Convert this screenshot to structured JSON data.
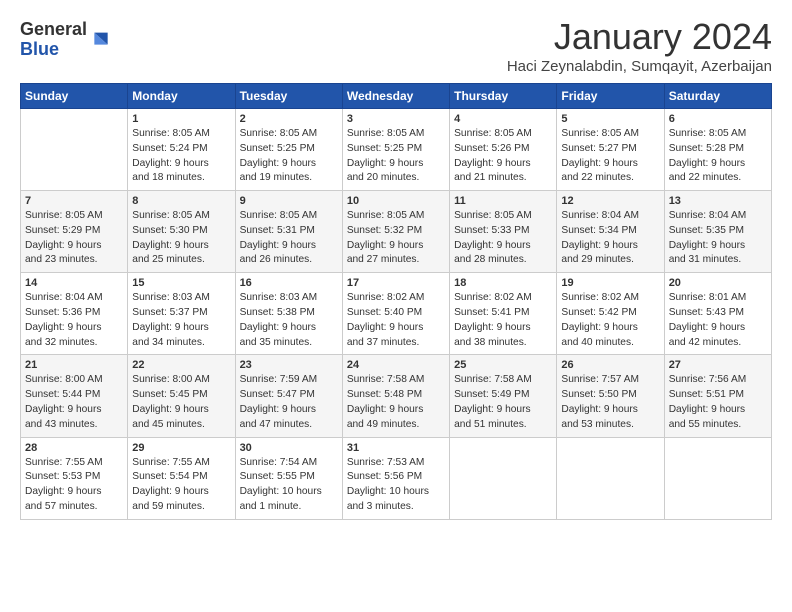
{
  "logo": {
    "general": "General",
    "blue": "Blue"
  },
  "header": {
    "month": "January 2024",
    "location": "Haci Zeynalabdin, Sumqayit, Azerbaijan"
  },
  "weekdays": [
    "Sunday",
    "Monday",
    "Tuesday",
    "Wednesday",
    "Thursday",
    "Friday",
    "Saturday"
  ],
  "weeks": [
    [
      {
        "day": "",
        "info": ""
      },
      {
        "day": "1",
        "info": "Sunrise: 8:05 AM\nSunset: 5:24 PM\nDaylight: 9 hours\nand 18 minutes."
      },
      {
        "day": "2",
        "info": "Sunrise: 8:05 AM\nSunset: 5:25 PM\nDaylight: 9 hours\nand 19 minutes."
      },
      {
        "day": "3",
        "info": "Sunrise: 8:05 AM\nSunset: 5:25 PM\nDaylight: 9 hours\nand 20 minutes."
      },
      {
        "day": "4",
        "info": "Sunrise: 8:05 AM\nSunset: 5:26 PM\nDaylight: 9 hours\nand 21 minutes."
      },
      {
        "day": "5",
        "info": "Sunrise: 8:05 AM\nSunset: 5:27 PM\nDaylight: 9 hours\nand 22 minutes."
      },
      {
        "day": "6",
        "info": "Sunrise: 8:05 AM\nSunset: 5:28 PM\nDaylight: 9 hours\nand 22 minutes."
      }
    ],
    [
      {
        "day": "7",
        "info": "Sunrise: 8:05 AM\nSunset: 5:29 PM\nDaylight: 9 hours\nand 23 minutes."
      },
      {
        "day": "8",
        "info": "Sunrise: 8:05 AM\nSunset: 5:30 PM\nDaylight: 9 hours\nand 25 minutes."
      },
      {
        "day": "9",
        "info": "Sunrise: 8:05 AM\nSunset: 5:31 PM\nDaylight: 9 hours\nand 26 minutes."
      },
      {
        "day": "10",
        "info": "Sunrise: 8:05 AM\nSunset: 5:32 PM\nDaylight: 9 hours\nand 27 minutes."
      },
      {
        "day": "11",
        "info": "Sunrise: 8:05 AM\nSunset: 5:33 PM\nDaylight: 9 hours\nand 28 minutes."
      },
      {
        "day": "12",
        "info": "Sunrise: 8:04 AM\nSunset: 5:34 PM\nDaylight: 9 hours\nand 29 minutes."
      },
      {
        "day": "13",
        "info": "Sunrise: 8:04 AM\nSunset: 5:35 PM\nDaylight: 9 hours\nand 31 minutes."
      }
    ],
    [
      {
        "day": "14",
        "info": "Sunrise: 8:04 AM\nSunset: 5:36 PM\nDaylight: 9 hours\nand 32 minutes."
      },
      {
        "day": "15",
        "info": "Sunrise: 8:03 AM\nSunset: 5:37 PM\nDaylight: 9 hours\nand 34 minutes."
      },
      {
        "day": "16",
        "info": "Sunrise: 8:03 AM\nSunset: 5:38 PM\nDaylight: 9 hours\nand 35 minutes."
      },
      {
        "day": "17",
        "info": "Sunrise: 8:02 AM\nSunset: 5:40 PM\nDaylight: 9 hours\nand 37 minutes."
      },
      {
        "day": "18",
        "info": "Sunrise: 8:02 AM\nSunset: 5:41 PM\nDaylight: 9 hours\nand 38 minutes."
      },
      {
        "day": "19",
        "info": "Sunrise: 8:02 AM\nSunset: 5:42 PM\nDaylight: 9 hours\nand 40 minutes."
      },
      {
        "day": "20",
        "info": "Sunrise: 8:01 AM\nSunset: 5:43 PM\nDaylight: 9 hours\nand 42 minutes."
      }
    ],
    [
      {
        "day": "21",
        "info": "Sunrise: 8:00 AM\nSunset: 5:44 PM\nDaylight: 9 hours\nand 43 minutes."
      },
      {
        "day": "22",
        "info": "Sunrise: 8:00 AM\nSunset: 5:45 PM\nDaylight: 9 hours\nand 45 minutes."
      },
      {
        "day": "23",
        "info": "Sunrise: 7:59 AM\nSunset: 5:47 PM\nDaylight: 9 hours\nand 47 minutes."
      },
      {
        "day": "24",
        "info": "Sunrise: 7:58 AM\nSunset: 5:48 PM\nDaylight: 9 hours\nand 49 minutes."
      },
      {
        "day": "25",
        "info": "Sunrise: 7:58 AM\nSunset: 5:49 PM\nDaylight: 9 hours\nand 51 minutes."
      },
      {
        "day": "26",
        "info": "Sunrise: 7:57 AM\nSunset: 5:50 PM\nDaylight: 9 hours\nand 53 minutes."
      },
      {
        "day": "27",
        "info": "Sunrise: 7:56 AM\nSunset: 5:51 PM\nDaylight: 9 hours\nand 55 minutes."
      }
    ],
    [
      {
        "day": "28",
        "info": "Sunrise: 7:55 AM\nSunset: 5:53 PM\nDaylight: 9 hours\nand 57 minutes."
      },
      {
        "day": "29",
        "info": "Sunrise: 7:55 AM\nSunset: 5:54 PM\nDaylight: 9 hours\nand 59 minutes."
      },
      {
        "day": "30",
        "info": "Sunrise: 7:54 AM\nSunset: 5:55 PM\nDaylight: 10 hours\nand 1 minute."
      },
      {
        "day": "31",
        "info": "Sunrise: 7:53 AM\nSunset: 5:56 PM\nDaylight: 10 hours\nand 3 minutes."
      },
      {
        "day": "",
        "info": ""
      },
      {
        "day": "",
        "info": ""
      },
      {
        "day": "",
        "info": ""
      }
    ]
  ]
}
